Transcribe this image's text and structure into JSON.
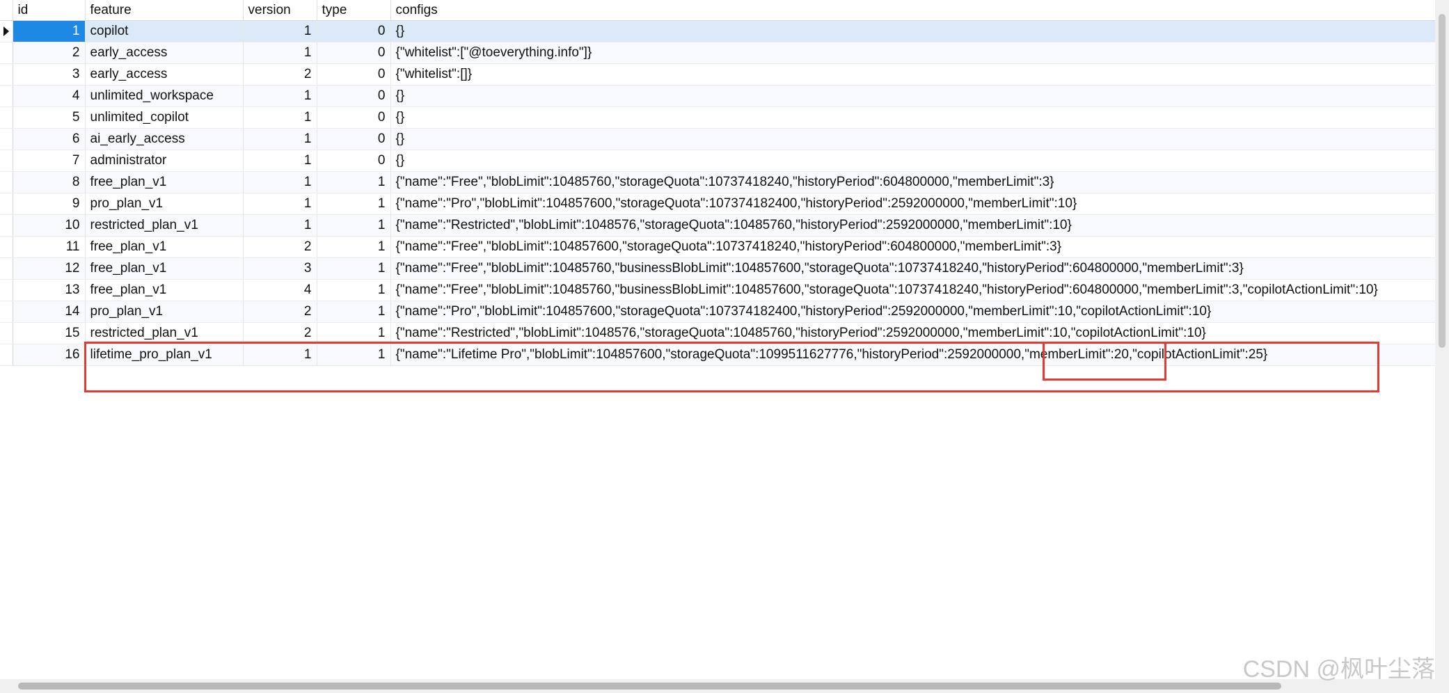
{
  "columns": [
    "id",
    "feature",
    "version",
    "type",
    "configs"
  ],
  "rows": [
    {
      "id": "1",
      "feature": "copilot",
      "version": "1",
      "type": "0",
      "configs": "{}"
    },
    {
      "id": "2",
      "feature": "early_access",
      "version": "1",
      "type": "0",
      "configs": "{\"whitelist\":[\"@toeverything.info\"]}"
    },
    {
      "id": "3",
      "feature": "early_access",
      "version": "2",
      "type": "0",
      "configs": "{\"whitelist\":[]}"
    },
    {
      "id": "4",
      "feature": "unlimited_workspace",
      "version": "1",
      "type": "0",
      "configs": "{}"
    },
    {
      "id": "5",
      "feature": "unlimited_copilot",
      "version": "1",
      "type": "0",
      "configs": "{}"
    },
    {
      "id": "6",
      "feature": "ai_early_access",
      "version": "1",
      "type": "0",
      "configs": "{}"
    },
    {
      "id": "7",
      "feature": "administrator",
      "version": "1",
      "type": "0",
      "configs": "{}"
    },
    {
      "id": "8",
      "feature": "free_plan_v1",
      "version": "1",
      "type": "1",
      "configs": "{\"name\":\"Free\",\"blobLimit\":10485760,\"storageQuota\":10737418240,\"historyPeriod\":604800000,\"memberLimit\":3}"
    },
    {
      "id": "9",
      "feature": "pro_plan_v1",
      "version": "1",
      "type": "1",
      "configs": "{\"name\":\"Pro\",\"blobLimit\":104857600,\"storageQuota\":107374182400,\"historyPeriod\":2592000000,\"memberLimit\":10}"
    },
    {
      "id": "10",
      "feature": "restricted_plan_v1",
      "version": "1",
      "type": "1",
      "configs": "{\"name\":\"Restricted\",\"blobLimit\":1048576,\"storageQuota\":10485760,\"historyPeriod\":2592000000,\"memberLimit\":10}"
    },
    {
      "id": "11",
      "feature": "free_plan_v1",
      "version": "2",
      "type": "1",
      "configs": "{\"name\":\"Free\",\"blobLimit\":104857600,\"storageQuota\":10737418240,\"historyPeriod\":604800000,\"memberLimit\":3}"
    },
    {
      "id": "12",
      "feature": "free_plan_v1",
      "version": "3",
      "type": "1",
      "configs": "{\"name\":\"Free\",\"blobLimit\":10485760,\"businessBlobLimit\":104857600,\"storageQuota\":10737418240,\"historyPeriod\":604800000,\"memberLimit\":3}"
    },
    {
      "id": "13",
      "feature": "free_plan_v1",
      "version": "4",
      "type": "1",
      "configs": "{\"name\":\"Free\",\"blobLimit\":10485760,\"businessBlobLimit\":104857600,\"storageQuota\":10737418240,\"historyPeriod\":604800000,\"memberLimit\":3,\"copilotActionLimit\":10}"
    },
    {
      "id": "14",
      "feature": "pro_plan_v1",
      "version": "2",
      "type": "1",
      "configs": "{\"name\":\"Pro\",\"blobLimit\":104857600,\"storageQuota\":107374182400,\"historyPeriod\":2592000000,\"memberLimit\":10,\"copilotActionLimit\":10}"
    },
    {
      "id": "15",
      "feature": "restricted_plan_v1",
      "version": "2",
      "type": "1",
      "configs": "{\"name\":\"Restricted\",\"blobLimit\":1048576,\"storageQuota\":10485760,\"historyPeriod\":2592000000,\"memberLimit\":10,\"copilotActionLimit\":10}"
    },
    {
      "id": "16",
      "feature": "lifetime_pro_plan_v1",
      "version": "1",
      "type": "1",
      "configs": "{\"name\":\"Lifetime Pro\",\"blobLimit\":104857600,\"storageQuota\":1099511627776,\"historyPeriod\":2592000000,\"memberLimit\":20,\"copilotActionLimit\":25}"
    }
  ],
  "selected_row": 0,
  "annotation_color": "#e53935",
  "watermark": "CSDN @枫叶尘落"
}
